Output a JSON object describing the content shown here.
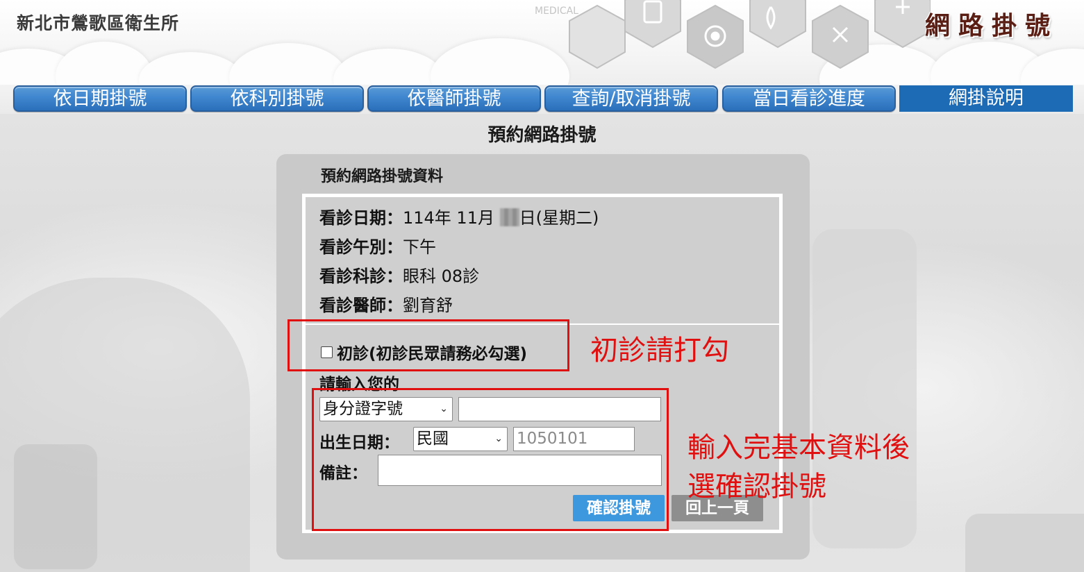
{
  "header": {
    "site_name": "新北市鶯歌區衛生所",
    "brand_logo": "網路掛號"
  },
  "nav": {
    "tabs": [
      {
        "label": "依日期掛號",
        "active": false
      },
      {
        "label": "依科別掛號",
        "active": false
      },
      {
        "label": "依醫師掛號",
        "active": false
      },
      {
        "label": "查詢/取消掛號",
        "active": false
      },
      {
        "label": "當日看診進度",
        "active": false
      },
      {
        "label": "網掛說明",
        "active": true
      }
    ]
  },
  "main": {
    "page_title": "預約網路掛號",
    "panel_title": "預約網路掛號資料",
    "info": {
      "date_label": "看診日期：",
      "date_value_a": "114年 11月",
      "date_value_b": "日(星期二)",
      "session_label": "看診午別：",
      "session_value": "下午",
      "clinic_label": "看診科診：",
      "clinic_value": "眼科 08診",
      "doctor_label": "看診醫師：",
      "doctor_value": "劉育舒"
    },
    "first_visit_label": "初診(初診民眾請務必勾選)",
    "first_visit_checked": false,
    "enter_label": "請輸入您的",
    "id_type_selected": "身分證字號",
    "id_value": "",
    "birth_label": "出生日期：",
    "birth_calendar_selected": "民國",
    "birth_placeholder": "1050101",
    "note_label": "備註：",
    "note_value": "",
    "confirm_button": "確認掛號",
    "back_button": "回上一頁"
  },
  "annotations": {
    "first_visit_hint": "初診請打勾",
    "form_hint_line1": "輸入完基本資料後",
    "form_hint_line2": "選確認掛號",
    "color": "#e01010"
  },
  "colors": {
    "tab_blue": "#3e86cf",
    "tab_active": "#1e6bb5",
    "confirm_blue": "#3d98de",
    "back_gray": "#8e8e8e",
    "panel_gray": "#c9c9c9"
  }
}
